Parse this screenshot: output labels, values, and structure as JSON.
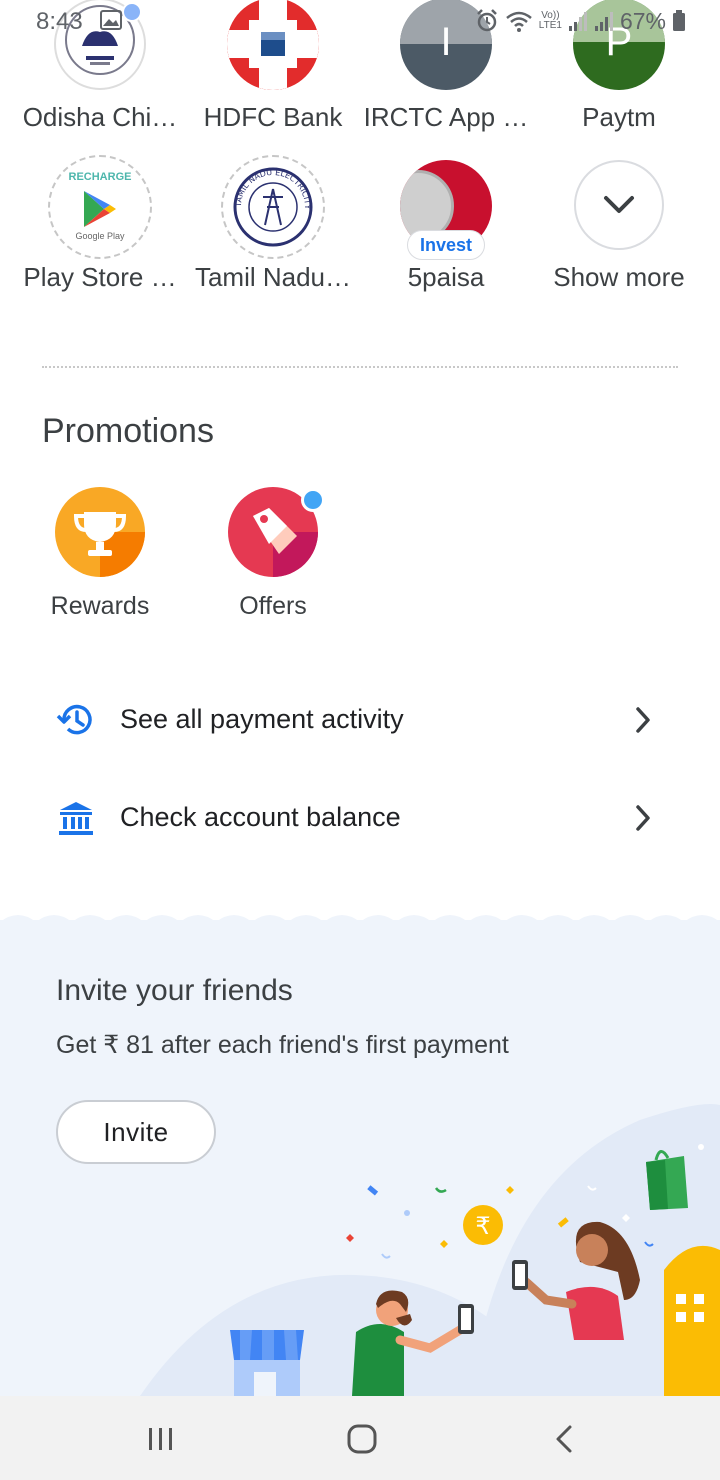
{
  "status_bar": {
    "time": "8:43",
    "network_top": "Vo))",
    "network_bottom": "LTE1",
    "battery": "67%"
  },
  "apps": [
    {
      "label": "Odisha Chi…",
      "icon": "odisha-emblem-icon"
    },
    {
      "label": "HDFC Bank",
      "icon": "hdfc-logo-icon"
    },
    {
      "label": "IRCTC App …",
      "icon": "letter-avatar",
      "initial": "I",
      "color": "#4c5a66"
    },
    {
      "label": "Paytm",
      "icon": "letter-avatar",
      "initial": "P",
      "color": "#2e6b1f"
    },
    {
      "label": "Play Store …",
      "icon": "google-play-recharge-icon",
      "badge_top": "RECHARGE",
      "badge_bottom": "Google Play"
    },
    {
      "label": "Tamil Nadu…",
      "icon": "tneb-logo-icon",
      "ring_text": "TAMIL NADU ELECTRICITY BOARD"
    },
    {
      "label": "5paisa",
      "icon": "5paisa-coin-icon",
      "badge": "Invest"
    },
    {
      "label": "Show more",
      "icon": "chevron-down-icon"
    }
  ],
  "promotions": {
    "title": "Promotions",
    "items": [
      {
        "label": "Rewards",
        "icon": "trophy-icon"
      },
      {
        "label": "Offers",
        "icon": "tag-icon"
      }
    ]
  },
  "actions": [
    {
      "label": "See all payment activity",
      "icon": "history-icon"
    },
    {
      "label": "Check account balance",
      "icon": "bank-icon"
    }
  ],
  "invite": {
    "title": "Invite your friends",
    "subtitle": "Get ₹ 81 after each friend's first payment",
    "button": "Invite",
    "coin_symbol": "₹"
  },
  "colors": {
    "accent_blue": "#1a73e8",
    "invite_bg": "#eff4fb",
    "rewards_orange": "#f9a825",
    "offers_red": "#e53952"
  }
}
